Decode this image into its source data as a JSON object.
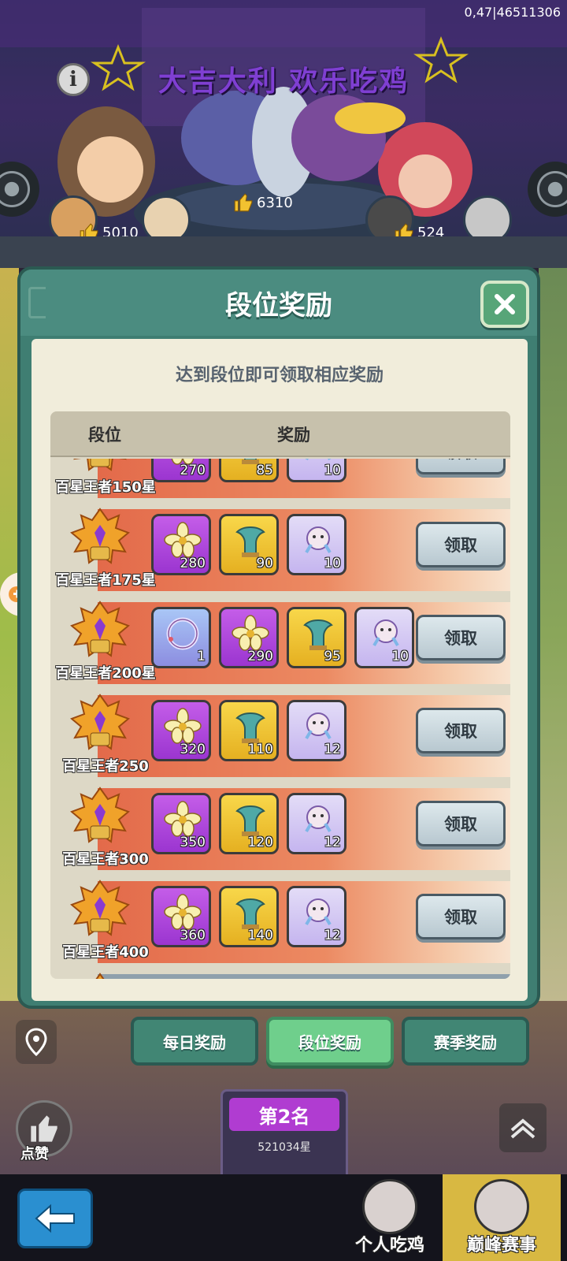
{
  "status": {
    "version": "0,47|46511306"
  },
  "banner": {
    "title": "大吉大利 欢乐吃鸡",
    "likes": [
      {
        "name": "left",
        "count": "5010"
      },
      {
        "name": "center",
        "count": "6310"
      },
      {
        "name": "right",
        "count": "524"
      }
    ]
  },
  "dialog": {
    "title": "段位奖励",
    "subtitle": "达到段位即可领取相应奖励",
    "headers": {
      "rank": "段位",
      "reward": "奖励"
    },
    "claim_label": "领取",
    "rows": [
      {
        "rank": "百星王者150星",
        "items": [
          {
            "type": "flower",
            "count": "270"
          },
          {
            "type": "horn",
            "count": "85"
          },
          {
            "type": "dragon",
            "count": "10"
          }
        ]
      },
      {
        "rank": "百星王者175星",
        "items": [
          {
            "type": "flower",
            "count": "280"
          },
          {
            "type": "horn",
            "count": "90"
          },
          {
            "type": "dragon",
            "count": "10"
          }
        ]
      },
      {
        "rank": "百星王者200星",
        "items": [
          {
            "type": "ring",
            "count": "1"
          },
          {
            "type": "flower",
            "count": "290"
          },
          {
            "type": "horn",
            "count": "95"
          },
          {
            "type": "dragon",
            "count": "10"
          }
        ]
      },
      {
        "rank": "百星王者250",
        "items": [
          {
            "type": "flower",
            "count": "320"
          },
          {
            "type": "horn",
            "count": "110"
          },
          {
            "type": "dragon",
            "count": "12"
          }
        ]
      },
      {
        "rank": "百星王者300",
        "items": [
          {
            "type": "flower",
            "count": "350"
          },
          {
            "type": "horn",
            "count": "120"
          },
          {
            "type": "dragon",
            "count": "12"
          }
        ]
      },
      {
        "rank": "百星王者400",
        "items": [
          {
            "type": "flower",
            "count": "360"
          },
          {
            "type": "horn",
            "count": "140"
          },
          {
            "type": "dragon",
            "count": "12"
          }
        ]
      }
    ]
  },
  "tabs": {
    "daily": "每日奖励",
    "rank": "段位奖励",
    "season": "赛季奖励",
    "active": "rank"
  },
  "bottom": {
    "like_label": "点赞",
    "place": {
      "title": "第2名",
      "stars": "521034星"
    },
    "nav": [
      {
        "label": "个人吃鸡",
        "active": false
      },
      {
        "label": "巅峰赛事",
        "active": true
      }
    ]
  },
  "colors": {
    "claim_button": "#c9d6dc",
    "row_gradient": "#e36a4a",
    "dialog": "#3f7e72",
    "active_tab": "#6fcf8c"
  }
}
